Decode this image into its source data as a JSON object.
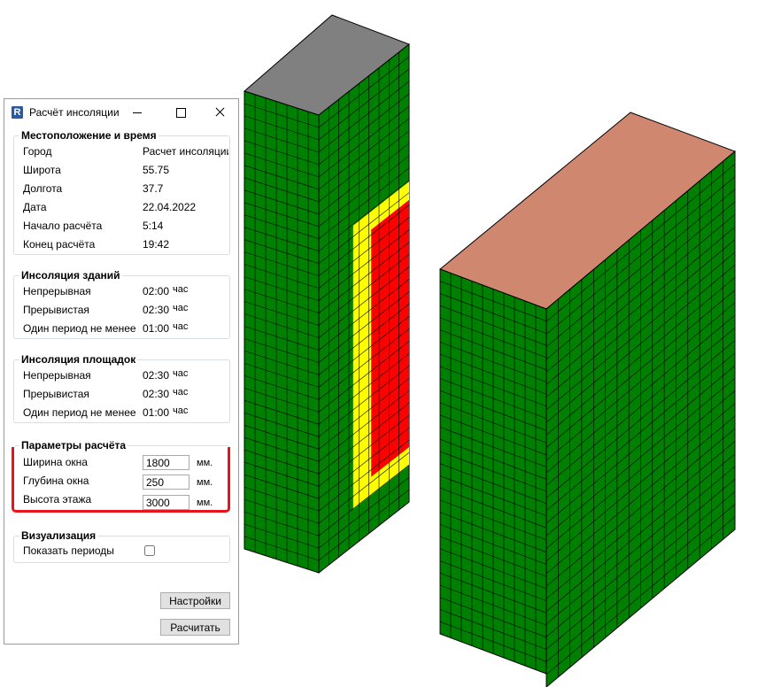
{
  "window": {
    "title": "Расчёт инсоляции",
    "icon_letter": "R"
  },
  "location": {
    "legend": "Местоположение и время",
    "rows": [
      {
        "label": "Город",
        "value": "Расчет инсоляции"
      },
      {
        "label": "Широта",
        "value": "55.75"
      },
      {
        "label": "Долгота",
        "value": "37.7"
      },
      {
        "label": "Дата",
        "value": "22.04.2022"
      },
      {
        "label": "Начало расчёта",
        "value": "5:14"
      },
      {
        "label": "Конец расчёта",
        "value": "19:42"
      }
    ]
  },
  "buildings": {
    "legend": "Инсоляция зданий",
    "rows": [
      {
        "label": "Непрерывная",
        "value": "02:00",
        "unit": "час"
      },
      {
        "label": "Прерывистая",
        "value": "02:30",
        "unit": "час"
      },
      {
        "label": "Один период не менее",
        "value": "01:00",
        "unit": "час"
      }
    ]
  },
  "sites": {
    "legend": "Инсоляция площадок",
    "rows": [
      {
        "label": "Непрерывная",
        "value": "02:30",
        "unit": "час"
      },
      {
        "label": "Прерывистая",
        "value": "02:30",
        "unit": "час"
      },
      {
        "label": "Один период не менее",
        "value": "01:00",
        "unit": "час"
      }
    ]
  },
  "params": {
    "legend": "Параметры расчёта",
    "rows": [
      {
        "label": "Ширина окна",
        "value": "1800",
        "unit": "мм."
      },
      {
        "label": "Глубина окна",
        "value": "250",
        "unit": "мм."
      },
      {
        "label": "Высота этажа",
        "value": "3000",
        "unit": "мм."
      }
    ]
  },
  "visualization": {
    "legend": "Визуализация",
    "show_periods_label": "Показать периоды",
    "show_periods_checked": false
  },
  "buttons": {
    "settings": "Настройки",
    "calculate": "Расчитать"
  },
  "colors": {
    "facade_green": "#008000",
    "insolation_yellow": "#ffff00",
    "insolation_red": "#ff0000",
    "roof_gray": "#808080",
    "roof_salmon": "#d08770",
    "highlight_red": "#e8141c"
  }
}
